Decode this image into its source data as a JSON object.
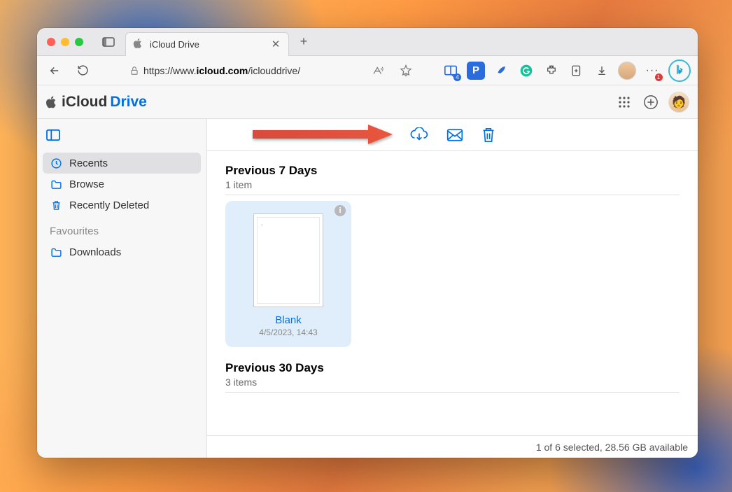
{
  "browser": {
    "tab_title": "iCloud Drive",
    "url_prefix": "https://www.",
    "url_host": "icloud.com",
    "url_path": "/iclouddrive/",
    "collections_badge": "4",
    "more_badge": "1"
  },
  "app": {
    "brand_primary": "iCloud",
    "brand_secondary": "Drive"
  },
  "sidebar": {
    "items": [
      {
        "label": "Recents",
        "icon": "clock",
        "active": true
      },
      {
        "label": "Browse",
        "icon": "folder",
        "active": false
      },
      {
        "label": "Recently Deleted",
        "icon": "trash",
        "active": false
      }
    ],
    "favourites_title": "Favourites",
    "favourites": [
      {
        "label": "Downloads",
        "icon": "folder"
      }
    ]
  },
  "sections": [
    {
      "title": "Previous 7 Days",
      "subtitle": "1 item",
      "files": [
        {
          "name": "Blank",
          "meta": "4/5/2023, 14:43",
          "selected": true
        }
      ]
    },
    {
      "title": "Previous 30 Days",
      "subtitle": "3 items",
      "files": []
    }
  ],
  "status": "1 of 6 selected, 28.56 GB available",
  "colors": {
    "accent": "#0071e3"
  }
}
